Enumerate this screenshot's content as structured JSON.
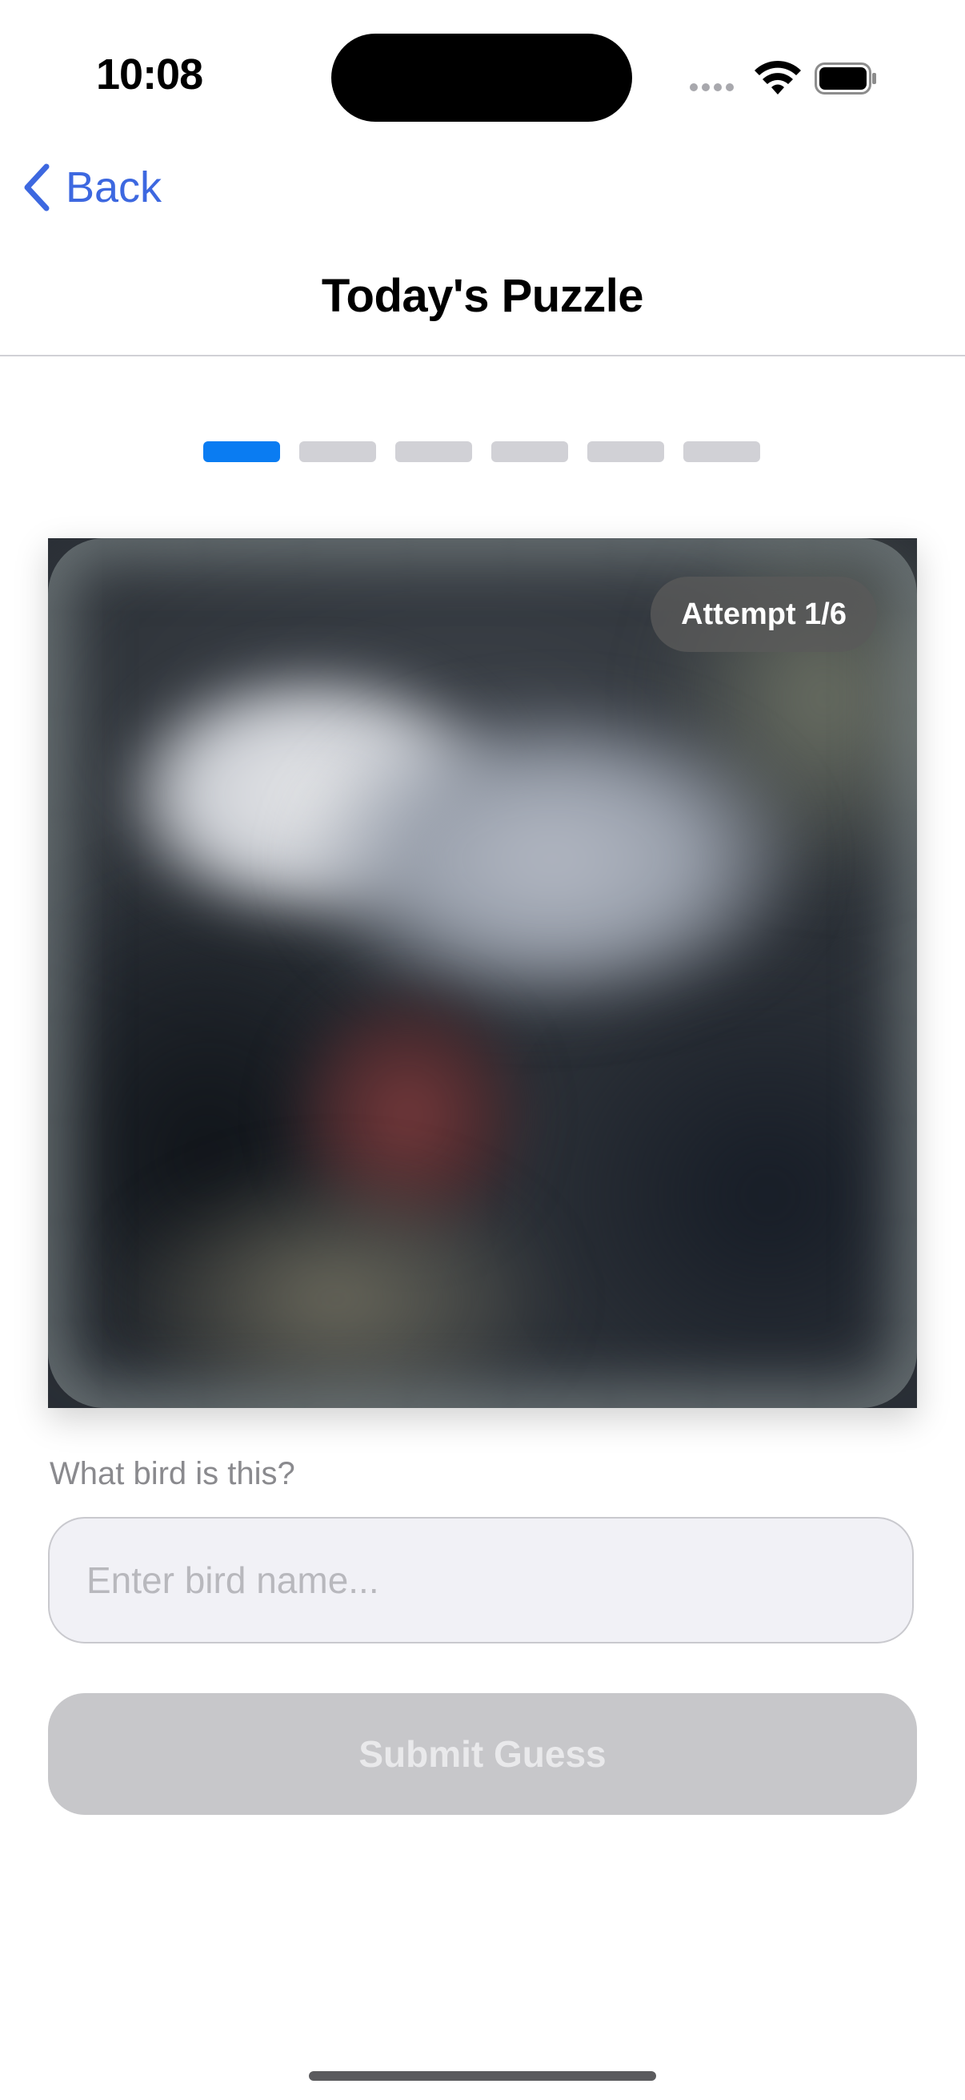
{
  "status_bar": {
    "time": "10:08",
    "icons": [
      "cellular-signal-icon",
      "wifi-icon",
      "battery-icon"
    ]
  },
  "nav": {
    "back_label": "Back",
    "back_icon": "chevron-left-icon",
    "title": "Today's Puzzle",
    "accent_color": "#3d68e0"
  },
  "progress": {
    "total": 6,
    "current": 1,
    "active_color": "#0a7cf2",
    "inactive_color": "#d1d1d6"
  },
  "puzzle": {
    "attempt_label": "Attempt 1/6",
    "image": "blurred-bird-photo"
  },
  "form": {
    "prompt": "What bird is this?",
    "placeholder": "Enter bird name...",
    "value": "",
    "submit_label": "Submit Guess",
    "submit_enabled": false
  }
}
